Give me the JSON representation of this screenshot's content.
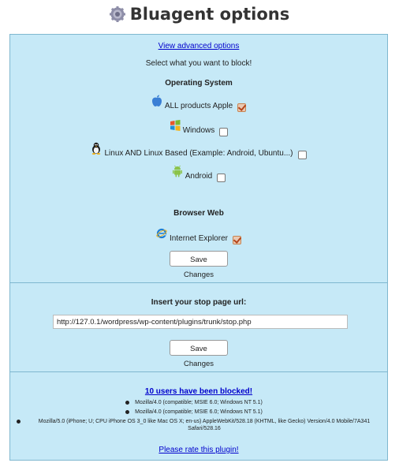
{
  "title": "Bluagent options",
  "main": {
    "advanced_link": "View advanced options",
    "instruction": "Select what you want to block!",
    "os_heading": "Operating System",
    "os_options": [
      {
        "icon": "apple-icon",
        "label": "ALL products Apple",
        "checked": true
      },
      {
        "icon": "windows-icon",
        "label": "Windows",
        "checked": false
      },
      {
        "icon": "linux-icon",
        "label": "Linux AND Linux Based (Example: Android, Ubuntu...)",
        "checked": false
      },
      {
        "icon": "android-icon",
        "label": "Android",
        "checked": false
      }
    ],
    "browser_heading": "Browser Web",
    "browser_options": [
      {
        "icon": "internet-explorer-icon",
        "label": "Internet Explorer",
        "checked": true
      }
    ],
    "save_label": "Save Changes"
  },
  "stop_page": {
    "label": "Insert your stop page url:",
    "url_value": "http://127.0.1/wordpress/wp-content/plugins/trunk/stop.php",
    "save_label": "Save Changes"
  },
  "blocked": {
    "summary_link": "10 users have been blocked!",
    "user_agents": [
      "Mozilla/4.0 (compatible; MSIE 6.0; Windows NT 5.1)",
      "Mozilla/4.0 (compatible; MSIE 6.0; Windows NT 5.1)",
      "Mozilla/5.0 (iPhone; U; CPU iPhone OS 3_0 like Mac OS X; en-us) AppleWebKit/528.18 (KHTML, like Gecko) Version/4.0 Mobile/7A341 Safari/528.16"
    ],
    "rate_link": "Please rate this plugin!"
  },
  "colors": {
    "panel_background": "#c6e9f7",
    "panel_border": "#7fb7cf",
    "link": "#0000cc",
    "checkbox_checked": "#b4451b"
  }
}
